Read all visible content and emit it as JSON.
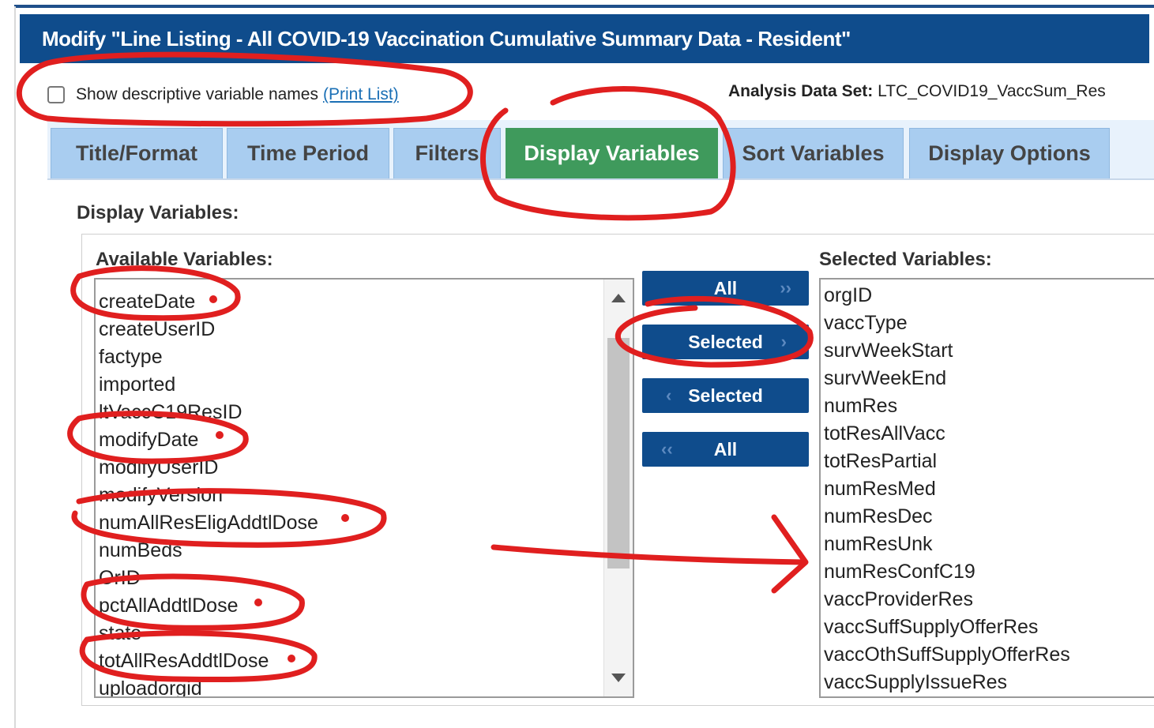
{
  "header": {
    "title": "Modify \"Line Listing - All COVID-19 Vaccination Cumulative Summary Data - Resident\""
  },
  "options": {
    "show_descriptive_label": "Show descriptive variable names",
    "print_list_link": "(Print List)",
    "dataset_label": "Analysis Data Set:",
    "dataset_value": "LTC_COVID19_VaccSum_Res"
  },
  "tabs": [
    {
      "label": "Title/Format"
    },
    {
      "label": "Time Period"
    },
    {
      "label": "Filters"
    },
    {
      "label": "Display Variables",
      "active": true
    },
    {
      "label": "Sort Variables"
    },
    {
      "label": "Display Options"
    }
  ],
  "section_label": "Display Variables:",
  "available": {
    "title": "Available Variables:",
    "items": [
      "createDate",
      "createUserID",
      "factype",
      "imported",
      "ltVaccC19ResID",
      "modifyDate",
      "modifyUserID",
      "modifyVersion",
      "numAllResEligAddtlDose",
      "numBeds",
      "OrID",
      "pctAllAddtlDose",
      "state",
      "totAllResAddtlDose",
      "uploadorgid"
    ]
  },
  "buttons": {
    "add_all": "All",
    "add_selected": "Selected",
    "remove_selected": "Selected",
    "remove_all": "All",
    "right_glyph": "››",
    "right_single_glyph": "›",
    "left_single_glyph": "‹",
    "left_glyph": "‹‹"
  },
  "selected": {
    "title": "Selected Variables:",
    "items": [
      "orgID",
      "vaccType",
      "survWeekStart",
      "survWeekEnd",
      "numRes",
      "totResAllVacc",
      "totResPartial",
      "numResMed",
      "numResDec",
      "numResUnk",
      "numResConfC19",
      "vaccProviderRes",
      "vaccSuffSupplyOfferRes",
      "vaccOthSuffSupplyOfferRes",
      "vaccSupplyIssueRes"
    ]
  },
  "colors": {
    "header": "#0f4c8c",
    "active_tab": "#3f9a5c",
    "tab": "#a9cdf0",
    "annotation": "#e01f1f"
  }
}
